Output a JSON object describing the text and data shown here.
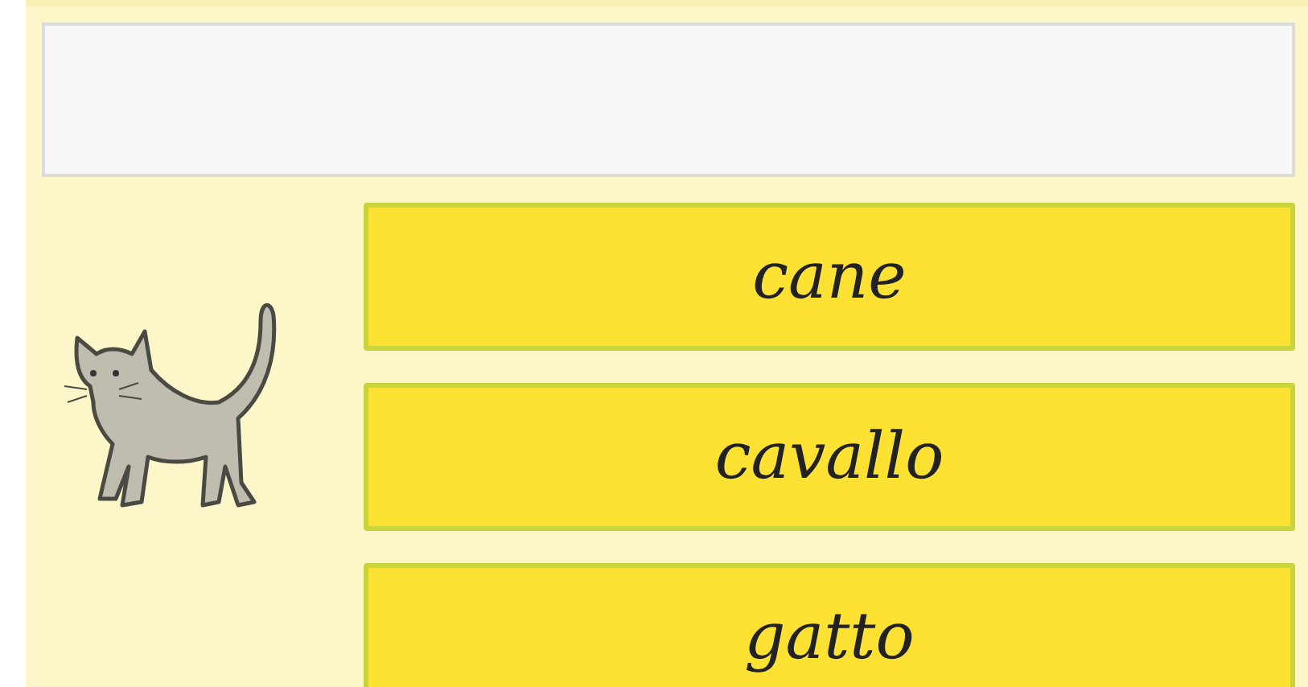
{
  "options": [
    {
      "label": "cane"
    },
    {
      "label": "cavallo"
    },
    {
      "label": "gatto"
    }
  ]
}
